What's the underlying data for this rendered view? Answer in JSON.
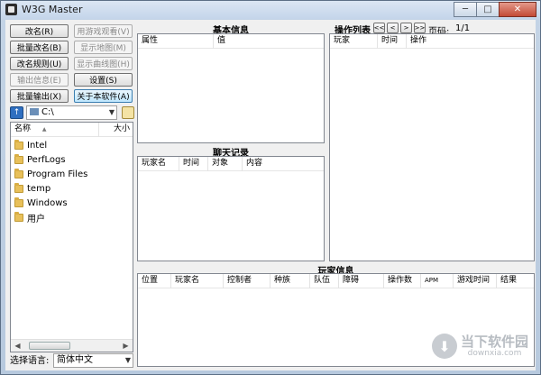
{
  "window": {
    "title": "W3G Master"
  },
  "titlebar_buttons": {
    "minimize": "─",
    "maximize": "□",
    "close": "✕"
  },
  "buttons": {
    "rename": "改名(R)",
    "watch_in_game": "用游戏观看(V)",
    "batch_rename": "批量改名(B)",
    "show_map": "显示地图(M)",
    "rename_rules": "改名规则(U)",
    "show_curve": "显示曲线图(H)",
    "output_info": "输出信息(E)",
    "settings": "设置(S)",
    "batch_output": "批量输出(X)",
    "about": "关于本软件(A)"
  },
  "drive": {
    "label": "C:\\",
    "arrow": "▼"
  },
  "file_list": {
    "col_name": "名称",
    "col_size": "大小",
    "sort_arrow": "▲",
    "items": [
      "Intel",
      "PerfLogs",
      "Program Files",
      "temp",
      "Windows",
      "用户"
    ]
  },
  "language": {
    "label": "选择语言:",
    "value": "简体中文"
  },
  "basic_info": {
    "title": "基本信息",
    "columns": [
      "属性",
      "值"
    ]
  },
  "chat_log": {
    "title": "聊天记录",
    "columns": [
      "玩家名",
      "时间",
      "对象",
      "内容"
    ]
  },
  "action_list": {
    "title": "操作列表",
    "nav": [
      "<<",
      "<",
      ">",
      ">>"
    ],
    "page_label": "页码:",
    "page_value": "1/1",
    "columns": [
      "玩家",
      "时间",
      "操作"
    ]
  },
  "player_info": {
    "title": "玩家信息",
    "columns": [
      "位置",
      "玩家名",
      "控制者",
      "种族",
      "队伍",
      "障碍",
      "操作数",
      "APM",
      "游戏时间",
      "结果"
    ]
  },
  "watermark": {
    "main": "当下软件园",
    "sub": "downxia.com"
  }
}
